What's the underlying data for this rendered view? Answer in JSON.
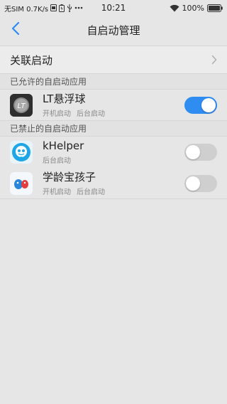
{
  "status_bar": {
    "left_text": "无SIM 0.7K/s",
    "time": "10:21",
    "battery": "100%",
    "icons": [
      "sim-card-icon",
      "battery-saver-icon",
      "usb-icon",
      "more-icon",
      "wifi-icon",
      "battery-icon"
    ]
  },
  "header": {
    "title": "自启动管理",
    "back_icon": "chevron-left-icon",
    "accent": "#2f8cf0"
  },
  "associated": {
    "label": "关联启动",
    "icon": "chevron-right-icon"
  },
  "allowed": {
    "section_label": "已允许的自启动应用",
    "apps": [
      {
        "name": "LT悬浮球",
        "subs": [
          "开机启动",
          "后台启动"
        ],
        "enabled": true,
        "icon": "lt-app-icon"
      }
    ]
  },
  "blocked": {
    "section_label": "已禁止的自启动应用",
    "apps": [
      {
        "name": "kHelper",
        "subs": [
          "后台启动"
        ],
        "enabled": false,
        "icon": "khelper-app-icon"
      },
      {
        "name": "学龄宝孩子",
        "subs": [
          "开机启动",
          "后台启动"
        ],
        "enabled": false,
        "icon": "xuelingbao-app-icon"
      }
    ]
  },
  "colors": {
    "toggle_on": "#2f8cf0",
    "toggle_off": "#cfcfcf",
    "background": "#e6e6e6"
  }
}
